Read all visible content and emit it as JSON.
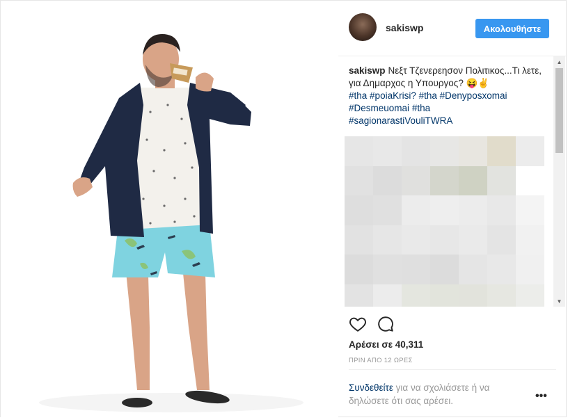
{
  "post": {
    "username": "sakiswp",
    "follow_label": "Ακολουθήστε",
    "caption": {
      "username": "sakiswp",
      "text": "Νεξτ Τζενερεησον Πολιτικος...Τι λετε, για Δημαρχος η Υπουργος?",
      "emoji": "😝✌",
      "hashtags": [
        "#tha",
        "#poiaKrisi?",
        "#tha",
        "#Denyposxomai",
        "#Desmeuomai",
        "#tha",
        "#sagionarastiVouliTWRA"
      ]
    },
    "likes_label": "Αρέσει σε 40,311",
    "time_label": "ΠΡΙΝ ΑΠΟ 12 ΩΡΕΣ",
    "login": {
      "link": "Συνδεθείτε",
      "rest": "για να σχολιάσετε ή να δηλώσετε ότι σας αρέσει."
    },
    "more_label": "•••"
  },
  "icons": {
    "like": "heart-outline-icon",
    "comment": "speech-bubble-icon",
    "more": "ellipsis-icon",
    "scroll_up": "triangle-up-icon",
    "scroll_down": "triangle-down-icon"
  },
  "colors": {
    "follow_button": "#3897f0",
    "link": "#003569",
    "muted": "#999999",
    "text": "#262626",
    "jacket": "#1f2a44",
    "shorts": "#7fd3e0"
  }
}
